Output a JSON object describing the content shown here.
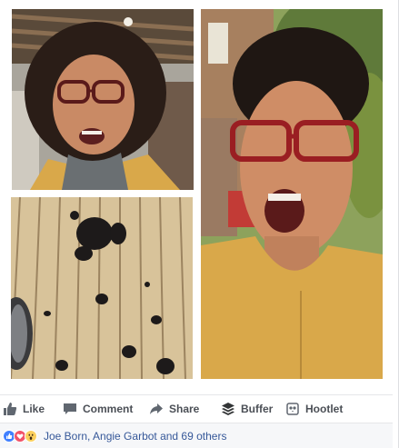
{
  "post": {
    "actions": {
      "like_label": "Like",
      "comment_label": "Comment",
      "share_label": "Share",
      "buffer_label": "Buffer",
      "hootlet_label": "Hootlet"
    },
    "reactions": {
      "icons": [
        "like-reaction-icon",
        "love-reaction-icon",
        "wow-reaction-icon"
      ],
      "summary": "Joe Born, Angie Garbot and 69 others"
    },
    "photos": [
      {
        "name": "photo-selfie-before"
      },
      {
        "name": "photo-cut-hair-on-deck"
      },
      {
        "name": "photo-selfie-after"
      }
    ]
  },
  "colors": {
    "link": "#365899",
    "action_text": "#4b4f56",
    "like_blue": "#4080ff",
    "love_red": "#f25268",
    "wow_yellow": "#fcd05e"
  }
}
